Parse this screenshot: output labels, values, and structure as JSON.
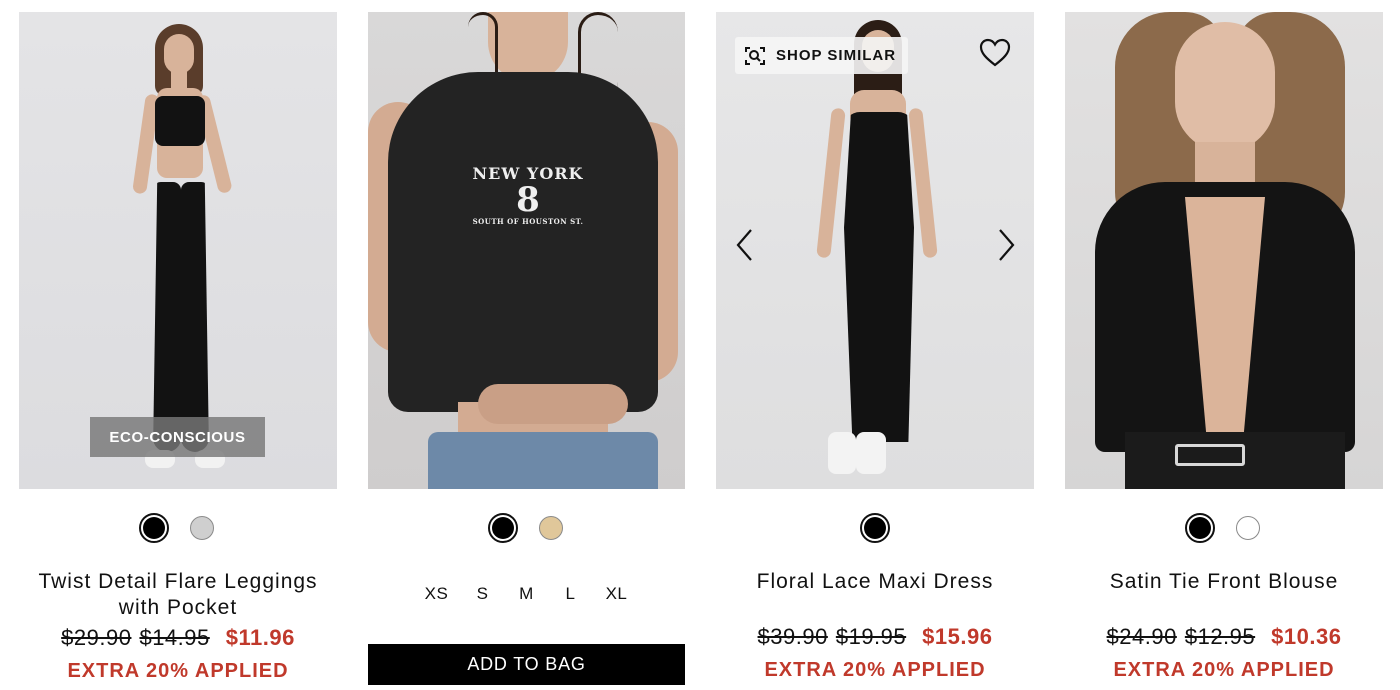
{
  "products": [
    {
      "name": "Twist Detail Flare Leggings with Pocket",
      "badge": "ECO-CONSCIOUS",
      "swatches": [
        "#000000",
        "#cfcfcf"
      ],
      "original_price": "$29.90",
      "was_price": "$14.95",
      "sale_price": "$11.96",
      "promo": "EXTRA 20% APPLIED"
    },
    {
      "print_line1": "NEW YORK",
      "print_number": "8",
      "print_line3": "SOUTH OF HOUSTON ST.",
      "swatches": [
        "#000000",
        "#e0c79a"
      ],
      "sizes": [
        "XS",
        "S",
        "M",
        "L",
        "XL"
      ],
      "add_to_bag": "ADD TO BAG"
    },
    {
      "name": "Floral Lace Maxi Dress",
      "shop_similar": "SHOP SIMILAR",
      "swatches": [
        "#000000"
      ],
      "original_price": "$39.90",
      "was_price": "$19.95",
      "sale_price": "$15.96",
      "promo": "EXTRA 20% APPLIED"
    },
    {
      "name": "Satin Tie Front Blouse",
      "swatches": [
        "#000000",
        "#ffffff"
      ],
      "original_price": "$24.90",
      "was_price": "$12.95",
      "sale_price": "$10.36",
      "promo": "EXTRA 20% APPLIED"
    }
  ],
  "colors": {
    "sale_red": "#c0392b",
    "text": "#111111",
    "button_bg": "#000000"
  },
  "icons": {
    "shop_similar": "scan-search-icon",
    "wishlist": "heart-icon",
    "prev": "chevron-left-icon",
    "next": "chevron-right-icon"
  }
}
